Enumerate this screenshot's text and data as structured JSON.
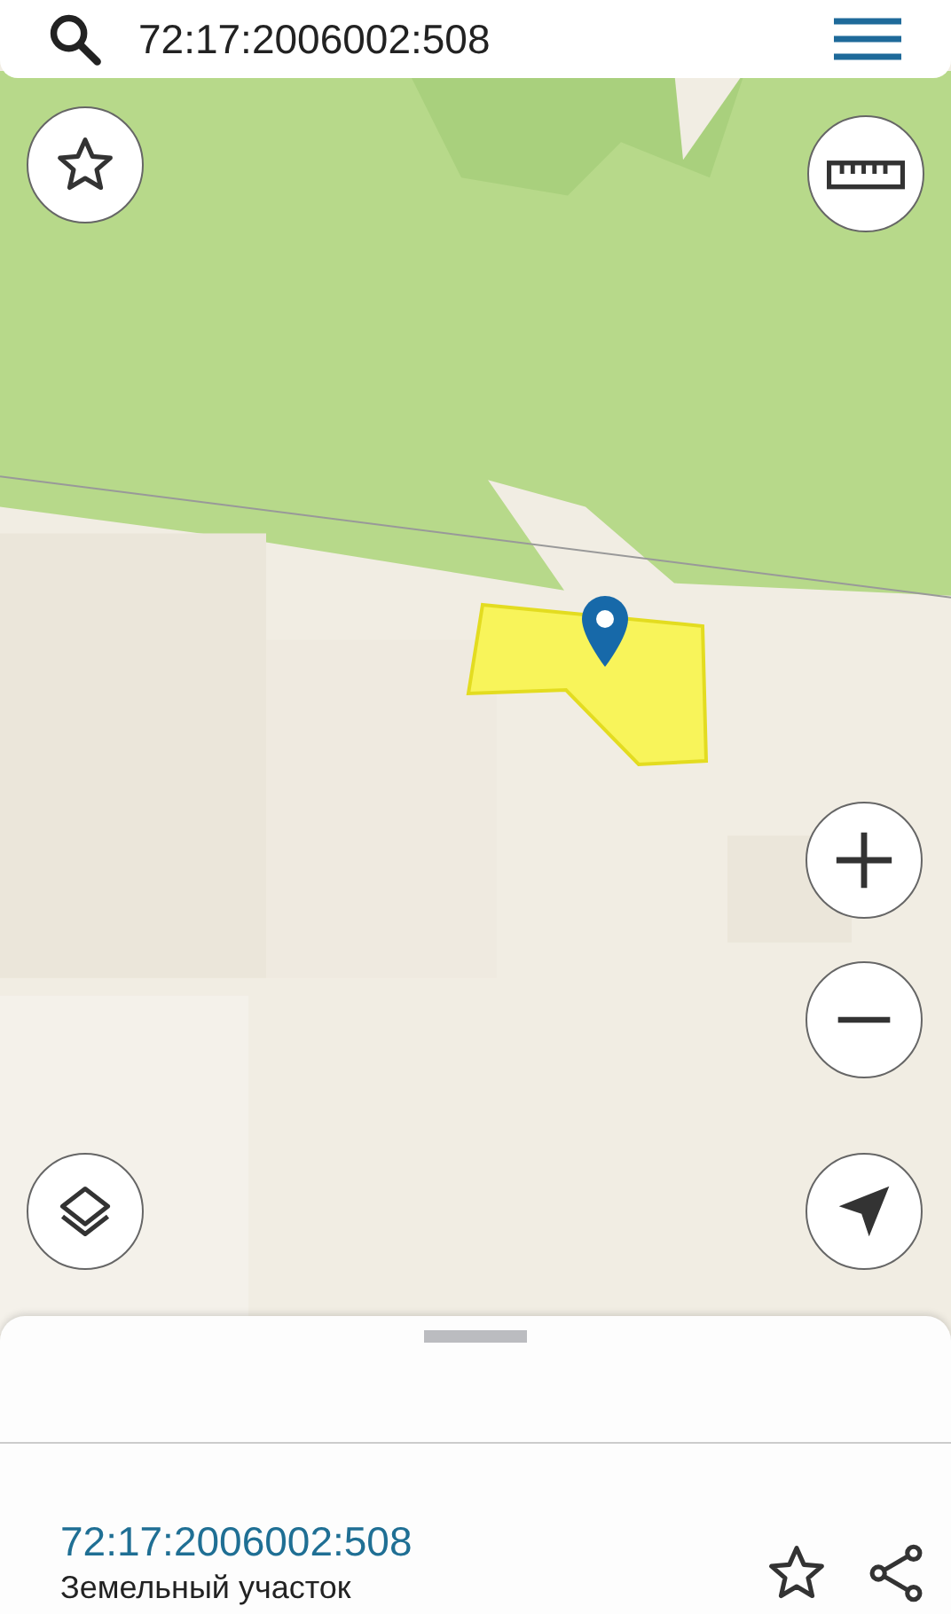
{
  "search": {
    "value": "72:17:2006002:508"
  },
  "sheet": {
    "title": "72:17:2006002:508",
    "subtitle": "Земельный участок"
  }
}
